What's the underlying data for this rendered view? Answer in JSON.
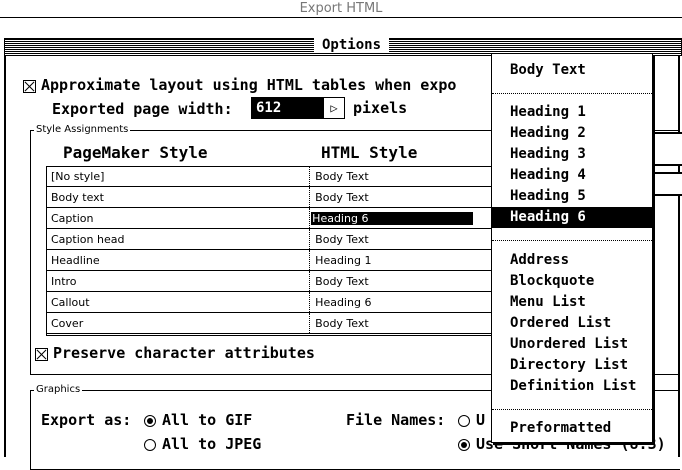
{
  "window": {
    "title": "Export HTML"
  },
  "header": {
    "options_label": "Options"
  },
  "layout_option": {
    "approximate_label": "Approximate layout using HTML tables when expo",
    "page_width_label": "Exported page width:",
    "page_width_value": "612",
    "page_width_unit": "pixels"
  },
  "style_assignments": {
    "group_label": "Style Assignments",
    "col_pagemaker": "PageMaker Style",
    "col_html": "HTML Style",
    "rows": [
      {
        "pm": "[No style]",
        "html": "Body Text"
      },
      {
        "pm": "Body text",
        "html": "Body Text"
      },
      {
        "pm": "Caption",
        "html": "Heading 6"
      },
      {
        "pm": "Caption head",
        "html": "Body Text"
      },
      {
        "pm": "Headline",
        "html": "Heading 1"
      },
      {
        "pm": "Intro",
        "html": "Body Text"
      },
      {
        "pm": "Callout",
        "html": "Heading 6"
      },
      {
        "pm": "Cover",
        "html": "Body Text"
      }
    ],
    "preserve_label": "Preserve character attributes"
  },
  "graphics": {
    "group_label": "Graphics",
    "export_as_label": "Export as:",
    "option_gif": "All to GIF",
    "option_jpeg": "All to JPEG",
    "file_names_label": "File Names:",
    "option_u": "U",
    "option_short": "Use Short Names (8.3)"
  },
  "popup_menu": {
    "items": [
      "Body Text",
      "Heading 1",
      "Heading 2",
      "Heading 3",
      "Heading 4",
      "Heading 5",
      "Heading 6",
      "Address",
      "Blockquote",
      "Menu List",
      "Ordered List",
      "Unordered List",
      "Directory List",
      "Definition List",
      "Preformatted"
    ],
    "selected": "Heading 6"
  }
}
